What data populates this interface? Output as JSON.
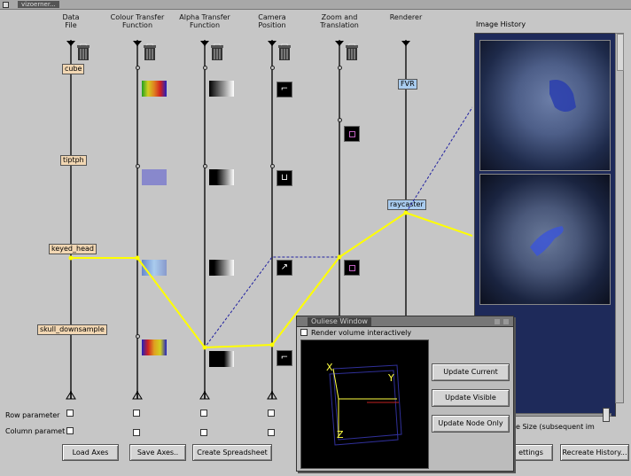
{
  "window": {
    "title": "vizoerner..."
  },
  "columns": [
    {
      "key": "data",
      "title": "Data\nFile"
    },
    {
      "key": "colour",
      "title": "Colour Transfer\nFunction"
    },
    {
      "key": "alpha",
      "title": "Alpha Transfer\nFunction"
    },
    {
      "key": "camera",
      "title": "Camera\nPosition"
    },
    {
      "key": "zoom",
      "title": "Zoom and\nTranslation"
    },
    {
      "key": "renderer",
      "title": "Renderer"
    }
  ],
  "nodes": {
    "data": [
      "cube",
      "tiptph",
      "keyed_head",
      "skull_downsample"
    ],
    "renderer": [
      "FVR",
      "raycaster"
    ]
  },
  "rows": {
    "row_param": "Row parameter",
    "col_param": "Column paramet"
  },
  "buttons": {
    "load_axes": "Load Axes",
    "save_axes": "Save Axes..",
    "create_spreadsheet": "Create Spreadsheet",
    "settings": "ettings",
    "recreate_history": "Recreate History..."
  },
  "history": {
    "title": "Image History",
    "image_size_label": "age Size (subsequent im"
  },
  "subwindow": {
    "title": "Ouliese Window",
    "render_check_label": "Render volume interactively",
    "buttons": [
      "Update Current",
      "Update Visible",
      "Update Node Only"
    ],
    "axis_labels": {
      "x": "X",
      "y": "Y",
      "z": "Z"
    }
  },
  "colors": {
    "path": "#ffff00",
    "blue_path": "#2020a0",
    "history_bg": "#1e2a5a"
  }
}
